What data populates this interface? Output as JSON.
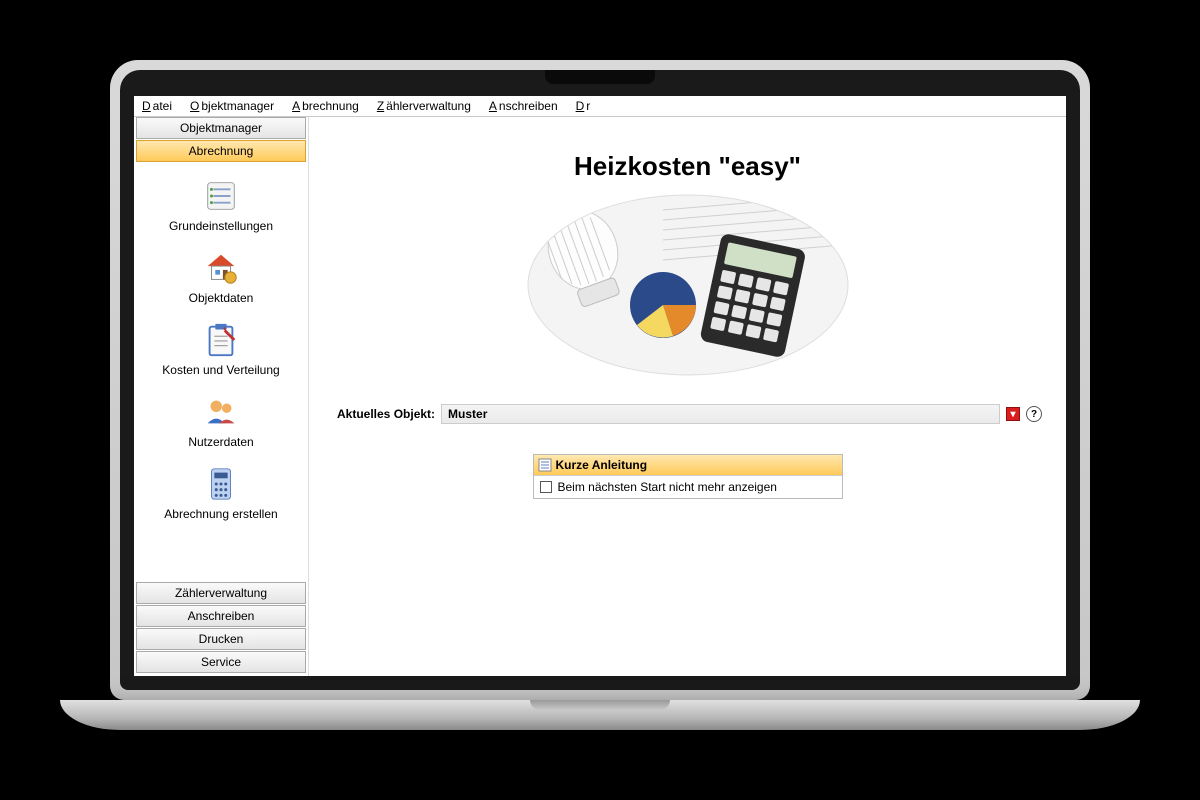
{
  "menubar": {
    "datei": {
      "mnemonic": "D",
      "rest": "atei"
    },
    "objektm": {
      "mnemonic": "O",
      "rest": "bjektmanager"
    },
    "abrech": {
      "mnemonic": "A",
      "rest": "brechnung"
    },
    "zaehler": {
      "mnemonic": "Z",
      "rest": "ählerverwaltung"
    },
    "anschr": {
      "mnemonic": "A",
      "rest": "nschreiben"
    },
    "drucken": {
      "mnemonic": "D",
      "rest": "r"
    }
  },
  "sidebar": {
    "top_buttons": {
      "objektmanager": "Objektmanager",
      "abrechnung": "Abrechnung"
    },
    "items": [
      {
        "label": "Grundeinstellungen",
        "icon": "checklist-icon"
      },
      {
        "label": "Objektdaten",
        "icon": "house-icon"
      },
      {
        "label": "Kosten und Verteilung",
        "icon": "clipboard-icon"
      },
      {
        "label": "Nutzerdaten",
        "icon": "people-icon"
      },
      {
        "label": "Abrechnung erstellen",
        "icon": "calculator-icon"
      }
    ],
    "bottom_buttons": {
      "zaehler": "Zählerverwaltung",
      "anschr": "Anschreiben",
      "drucken": "Drucken",
      "service": "Service"
    }
  },
  "main": {
    "title": "Heizkosten \"easy\"",
    "current_object_label": "Aktuelles Objekt:",
    "current_object_value": "Muster",
    "dropdown_glyph": "▾",
    "help_glyph": "?",
    "guide_title": "Kurze Anleitung",
    "hide_checkbox_label": "Beim nächsten Start nicht mehr anzeigen"
  }
}
